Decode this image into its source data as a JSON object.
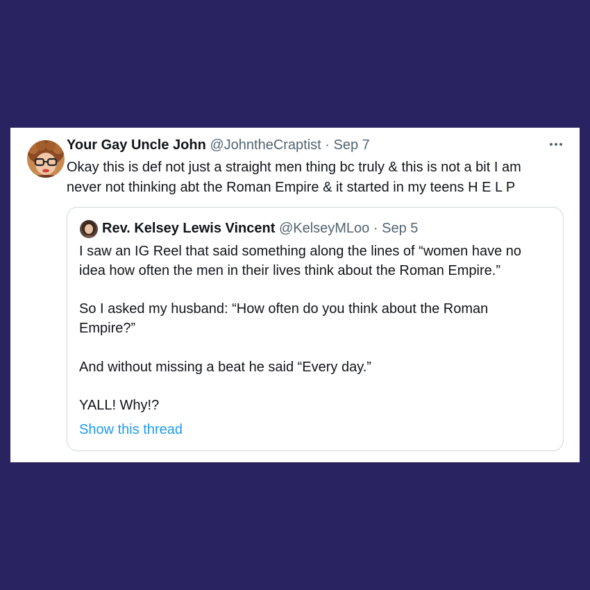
{
  "tweet": {
    "author_name": "Your Gay Uncle John",
    "handle": "@JohntheCraptist",
    "separator": "·",
    "date": "Sep 7",
    "more_icon": "more-horizontal-icon",
    "text_lines": [
      "Okay this is def not just a straight men thing bc truly & this is not a bit I am",
      "never not thinking abt the Roman Empire & it started in my teens H E L P"
    ]
  },
  "quote": {
    "author_name": "Rev. Kelsey Lewis Vincent",
    "handle": "@KelseyMLoo",
    "separator": "·",
    "date": "Sep 5",
    "text_lines": [
      "I saw an IG Reel that said something along the lines of “women have no",
      "idea how often the men in their lives think about the Roman Empire.”",
      "So I asked my husband: “How often do you think about the Roman",
      "Empire?”",
      "And without missing a beat he said “Every day.”",
      "YALL! Why!?"
    ],
    "show_thread_label": "Show this thread"
  },
  "colors": {
    "page_background": "#2a2362",
    "card_background": "#ffffff",
    "text_primary": "#0f1419",
    "text_muted": "#536471",
    "link": "#1d9bf0",
    "border": "#cfd9de"
  }
}
